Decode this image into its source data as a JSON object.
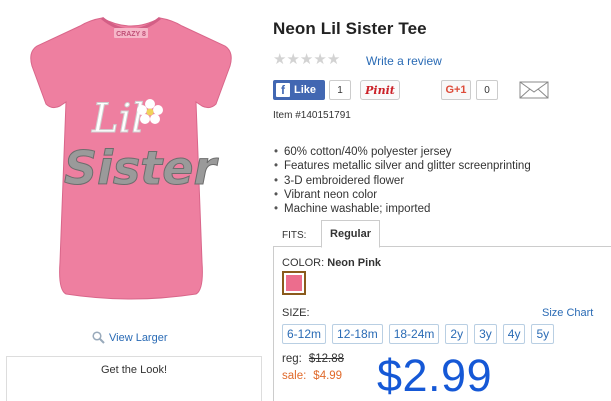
{
  "product": {
    "title": "Neon Lil Sister Tee",
    "image_alt": "Pink tee with Lil Sister print",
    "tee_text_line1": "Lil",
    "tee_text_line2": "Sister",
    "tee_tag_text": "CRAZY 8",
    "tee_color": "#ee7fa0"
  },
  "view_larger_label": "View Larger",
  "get_the_look_label": "Get the Look!",
  "review": {
    "stars": [
      "★",
      "★",
      "★",
      "★",
      "★"
    ],
    "write_review_label": "Write a review"
  },
  "social": {
    "fb_logo": "f",
    "fb_like_label": "Like",
    "fb_count": "1",
    "pin_label": "Pinit",
    "gplus_label": "G+1",
    "gplus_count": "0",
    "mail_icon": "envelope-icon"
  },
  "item_number": "Item #140151791",
  "features": [
    "60% cotton/40% polyester jersey",
    "Features metallic silver and glitter screenprinting",
    "3-D embroidered flower",
    "Vibrant neon color",
    "Machine washable; imported"
  ],
  "fits": {
    "label": "FITS:",
    "selected_tab": "Regular"
  },
  "color": {
    "label": "COLOR:",
    "value": "Neon Pink",
    "swatch_hex": "#ec6d8d"
  },
  "size": {
    "label": "SIZE:",
    "chart_label": "Size Chart",
    "options": [
      "6-12m",
      "12-18m",
      "18-24m",
      "2y",
      "3y",
      "4y",
      "5y"
    ]
  },
  "price": {
    "reg_label": "reg:",
    "reg_value": "$12.88",
    "sale_label": "sale:",
    "sale_value": "$4.99",
    "big_price": "$2.99"
  }
}
